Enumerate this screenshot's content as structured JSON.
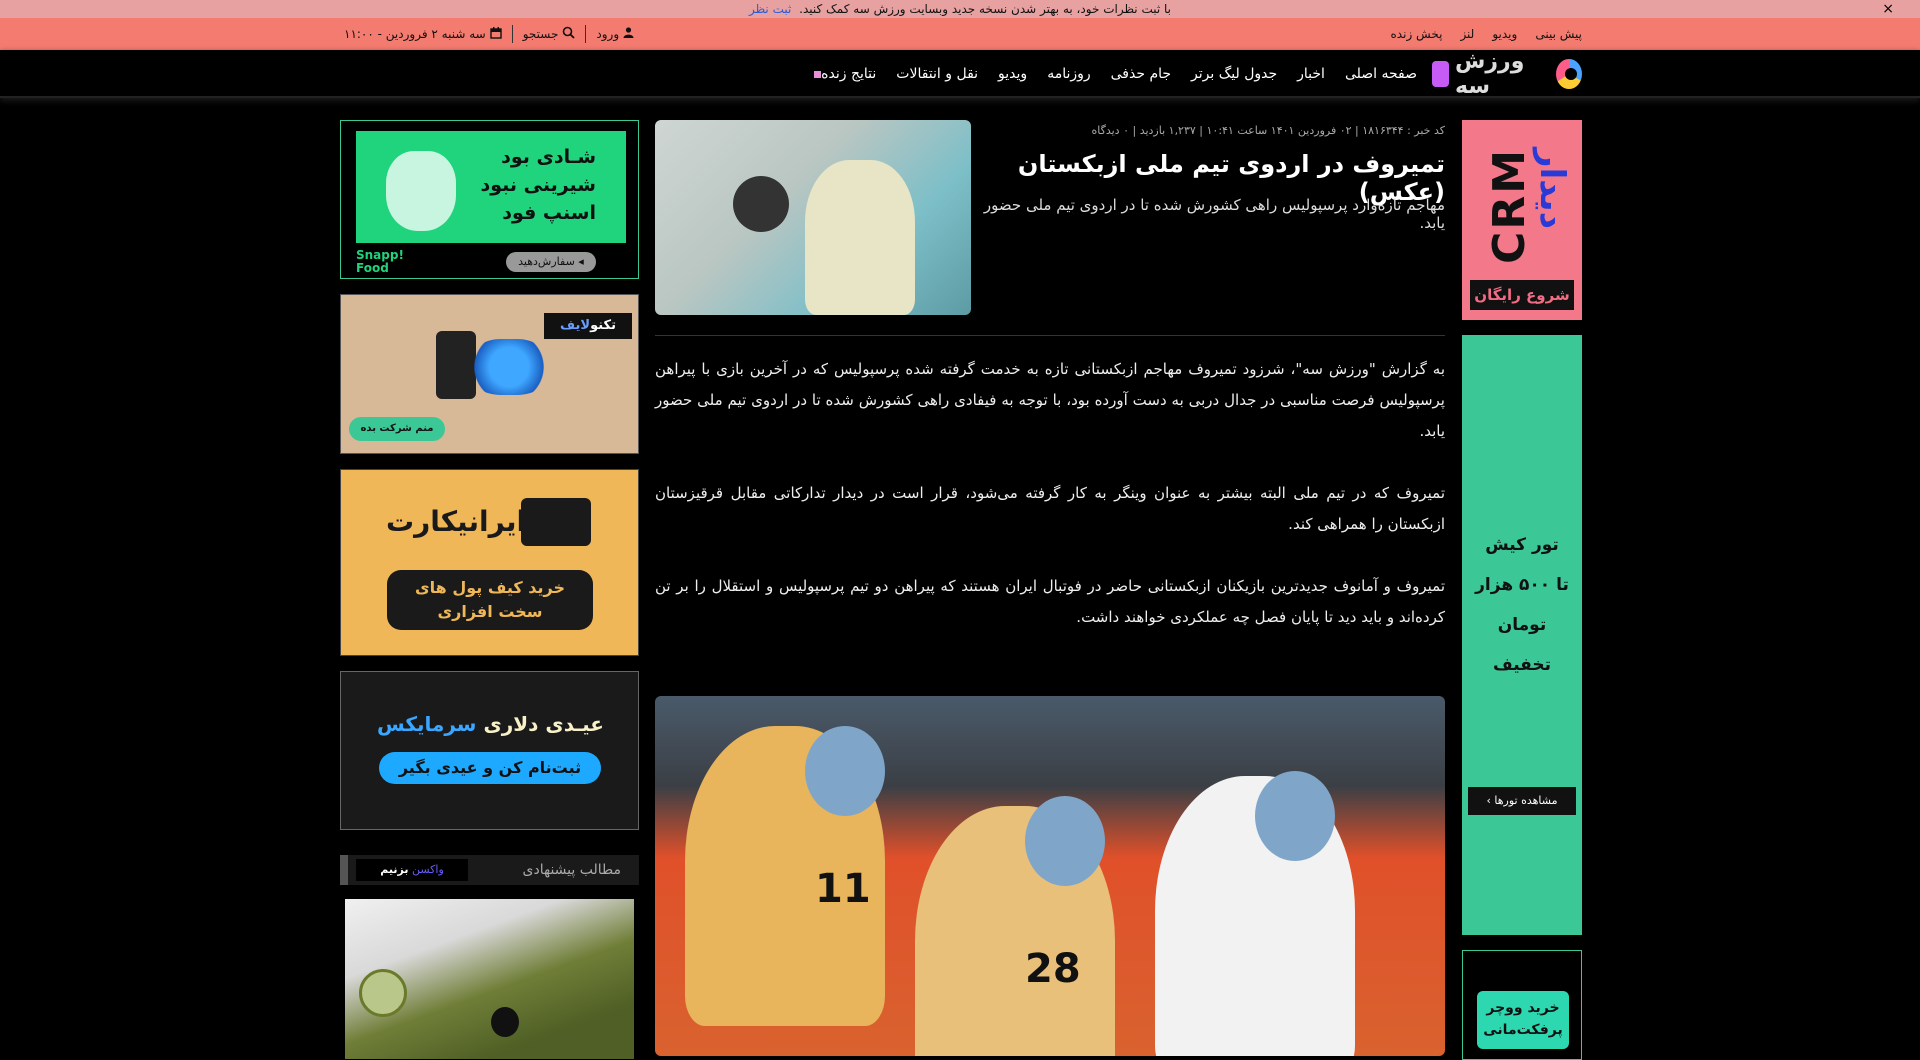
{
  "notice": {
    "text": "با ثبت نظرات خود، به بهتر شدن نسخه جدید وبسایت ورزش سه کمک کنید.",
    "link": "ثبت نظر",
    "close": "×"
  },
  "topbar": {
    "links": [
      "پیش بینی",
      "ویدیو",
      "لنز",
      "پخش زنده"
    ],
    "date": "سه شنبه ۲ فروردین - ۱۱:۰۰",
    "search": "جستجو",
    "login": "ورود"
  },
  "logo": {
    "text": "ورزش سه"
  },
  "nav": {
    "items": [
      "صفحه اصلی",
      "اخبار",
      "جدول لیگ برتر",
      "جام حذفی",
      "روزنامه",
      "ویدیو",
      "نقل و انتقالات",
      "نتایج زنده"
    ]
  },
  "article": {
    "meta": "کد خبر : ۱۸۱۶۳۴۴ | ۰۲ فروردین ۱۴۰۱ ساعت ۱۰:۴۱ | ۱,۲۳۷ بازدید | ۰ دیدگاه",
    "title": "تمیروف در اردوی تیم ملی ازبکستان (عکس)",
    "lead": "مهاجم تازه‌وارد پرسپولیس راهی کشورش شده تا در اردوی تیم ملی حضور یابد.",
    "paragraphs": [
      "به گزارش \"ورزش سه\"، شرزود تمیروف مهاجم ازبکستانی تازه به خدمت گرفته شده پرسپولیس که در آخرین بازی با پیراهن پرسپولیس فرصت مناسبی در جدال دربی به دست آورده بود، با توجه به فیفادی راهی کشورش شده تا در اردوی تیم ملی حضور یابد.",
      "تمیروف که در تیم ملی البته بیشتر به عنوان وینگر به کار گرفته می‌شود، قرار است در دیدار تدارکاتی مقابل قرقیزستان ازبکستان را همراهی کند.",
      "تمیروف و آمانوف جدیدترین بازیکنان ازبکستانی حاضر در فوتبال ایران هستند که پیراهن دو تیم پرسپولیس و استقلال را بر تن کرده‌اند و باید دید تا پایان فصل چه عملکردی خواهند داشت."
    ],
    "photo_numbers": [
      "11",
      "28"
    ]
  },
  "ads": {
    "crm": {
      "big": "CRM",
      "word": "دیدار",
      "button": "شروع رایگان"
    },
    "tour": {
      "lines": [
        "تور کیش",
        "تا ۵۰۰ هزار تومان",
        "تخفیف"
      ],
      "button": "مشاهده تورها"
    },
    "voucher": {
      "lines": [
        "خرید ووچر",
        "پرفکت‌مانی"
      ]
    },
    "snapp": {
      "lines": [
        "شـادی بود",
        "شیرینی نبود",
        "اسنپ فود"
      ],
      "brand1": "Snapp!",
      "brand2": "Food",
      "order": "سفارش‌دهید ◂"
    },
    "techno": {
      "logo_a": "تکنو",
      "logo_b": "لایف",
      "button": "منم شرکت بده"
    },
    "iranicard": {
      "logo": "ایرانیکارت",
      "btn1": "خرید کیف پول های",
      "btn2": "سخت افزاری"
    },
    "sarmayex": {
      "part1": "عیـدی دلاری",
      "part2": "سرمایکس",
      "button": "ثبت‌نام کن و عیدی بگیر"
    }
  },
  "suggest": {
    "title": "مطالب پیشنهادی",
    "vaccine_a": "واکسن",
    "vaccine_b": "بزنیم"
  }
}
